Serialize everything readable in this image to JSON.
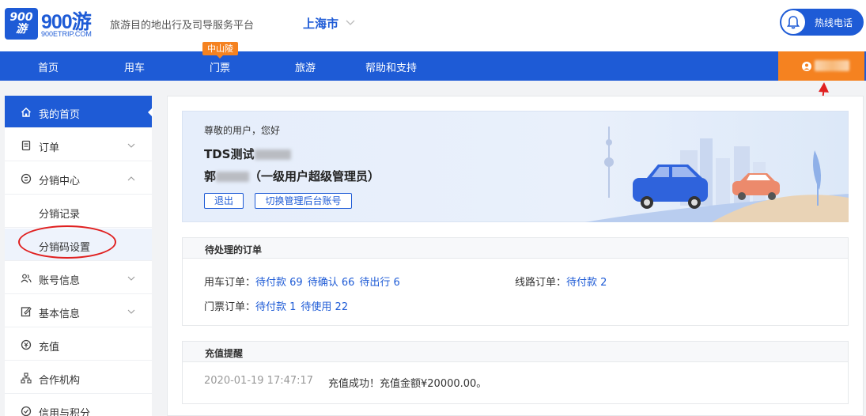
{
  "header": {
    "logo_badge": "900游",
    "logo_text": "900游",
    "logo_sub": "900ETRIP.COM",
    "tagline": "旅游目的地出行及司导服务平台",
    "city": "上海市",
    "hotline": "热线电话"
  },
  "nav": {
    "items": [
      "首页",
      "用车",
      "门票",
      "旅游",
      "帮助和支持"
    ],
    "badge": "中山陵"
  },
  "sidebar": {
    "items": [
      {
        "label": "我的首页",
        "icon": "home-icon"
      },
      {
        "label": "订单",
        "icon": "order-icon"
      },
      {
        "label": "分销中心",
        "icon": "distribution-icon"
      },
      {
        "label": "分销记录",
        "icon": ""
      },
      {
        "label": "分销码设置",
        "icon": ""
      },
      {
        "label": "账号信息",
        "icon": "users-icon"
      },
      {
        "label": "基本信息",
        "icon": "edit-icon"
      },
      {
        "label": "充值",
        "icon": "recharge-icon"
      },
      {
        "label": "合作机构",
        "icon": "org-icon"
      },
      {
        "label": "信用与积分",
        "icon": "credit-icon"
      }
    ]
  },
  "banner": {
    "greeting": "尊敬的用户，您好",
    "company_prefix": "TDS测试",
    "role_prefix": "郭",
    "role_suffix": "（一级用户超级管理员）",
    "logout": "退出",
    "switch_account": "切换管理后台账号"
  },
  "pending": {
    "title": "待处理的订单",
    "car_label": "用车订单：",
    "car_links": [
      "待付款 69",
      "待确认 66",
      "待出行 6"
    ],
    "route_label": "线路订单：",
    "route_links": [
      "待付款 2"
    ],
    "ticket_label": "门票订单：",
    "ticket_links": [
      "待付款 1",
      "待使用 22"
    ]
  },
  "recharge": {
    "title": "充值提醒",
    "time": "2020-01-19 17:47:17",
    "message": "充值成功！充值金额¥20000.00。"
  },
  "colors": {
    "primary": "#1e5bd6",
    "accent": "#f58220",
    "annotation": "#e02020"
  }
}
